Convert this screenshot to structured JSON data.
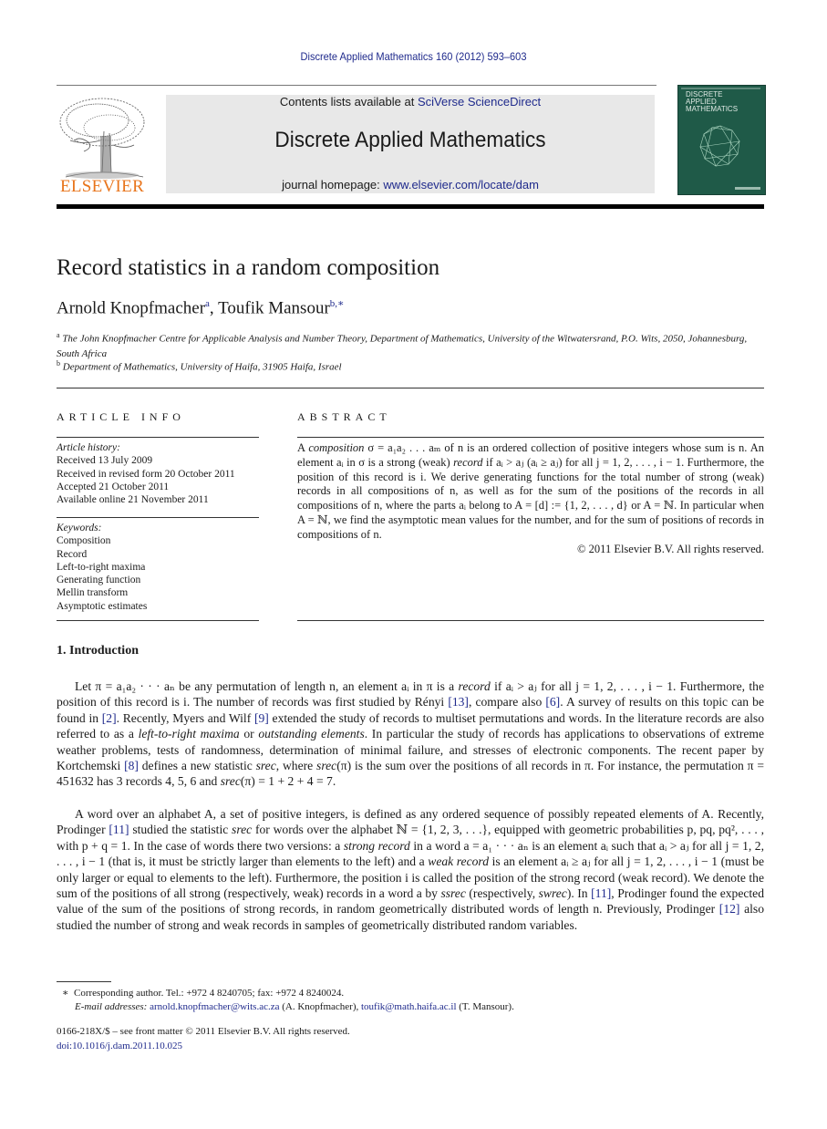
{
  "header": {
    "citation": "Discrete Applied Mathematics 160 (2012) 593–603",
    "contents_prefix": "Contents lists available at ",
    "contents_link": "SciVerse ScienceDirect",
    "journal_title": "Discrete Applied Mathematics",
    "homepage_prefix": "journal homepage: ",
    "homepage_link": "www.elsevier.com/locate/dam",
    "publisher_logo_text": "ELSEVIER",
    "cover_title_lines": [
      "DISCRETE",
      "APPLIED",
      "MATHEMATICS"
    ],
    "colors": {
      "link": "#1f2a8c",
      "elsevier_orange": "#e8741b",
      "cover_green": "#1f5a48",
      "banner_gray": "#e8e8e8"
    }
  },
  "article": {
    "title": "Record statistics in a random composition",
    "authors": [
      {
        "name": "Arnold Knopfmacher",
        "sup": "a"
      },
      {
        "name": "Toufik Mansour",
        "sup": "b,∗"
      }
    ],
    "author_separator": ", ",
    "affiliations": [
      {
        "sup": "a",
        "text": "The John Knopfmacher Centre for Applicable Analysis and Number Theory, Department of Mathematics, University of the Witwatersrand, P.O. Wits, 2050, Johannesburg, South Africa"
      },
      {
        "sup": "b",
        "text": "Department of Mathematics, University of Haifa, 31905 Haifa, Israel"
      }
    ]
  },
  "article_info": {
    "heading": "ARTICLE INFO",
    "history_label": "Article history:",
    "history": [
      "Received 13 July 2009",
      "Received in revised form 20 October 2011",
      "Accepted 21 October 2011",
      "Available online 21 November 2011"
    ],
    "keywords_label": "Keywords:",
    "keywords": [
      "Composition",
      "Record",
      "Left-to-right maxima",
      "Generating function",
      "Mellin transform",
      "Asymptotic estimates"
    ]
  },
  "abstract": {
    "heading": "ABSTRACT",
    "text_parts": [
      "A ",
      "composition",
      " σ = a₁a₂ . . . aₘ of n is an ordered collection of positive integers whose sum is n. An element aᵢ in σ is a strong (weak) ",
      "record",
      " if aᵢ > aⱼ (aᵢ ≥ aⱼ) for all j = 1, 2, . . . , i − 1. Furthermore, the position of this record is i. We derive generating functions for the total number of strong (weak) records in all compositions of n, as well as for the sum of the positions of the records in all compositions of n, where the parts aᵢ belong to A = [d] := {1, 2, . . . , d} or A = ℕ. In particular when A = ℕ, we find the asymptotic mean values for the number, and for the sum of positions of records in compositions of n."
    ],
    "copyright": "© 2011 Elsevier B.V. All rights reserved."
  },
  "introduction": {
    "heading": "1.  Introduction",
    "para1": [
      "Let π = a₁a₂ · · · aₙ be any permutation of length n, an element aᵢ in π is a ",
      "record",
      " if aᵢ > aⱼ for all j = 1, 2, . . . , i − 1. Furthermore, the position of this record is i. The number of records was first studied by Rényi ",
      "[13]",
      ", compare also ",
      "[6]",
      ". A survey of results on this topic can be found in ",
      "[2]",
      ". Recently, Myers and Wilf ",
      "[9]",
      " extended the study of records to multiset permutations and words. In the literature records are also referred to as a ",
      "left-to-right maxima",
      " or ",
      "outstanding elements",
      ". In particular the study of records has applications to observations of extreme weather problems, tests of randomness, determination of minimal failure, and stresses of electronic components. The recent paper by Kortchemski ",
      "[8]",
      " defines a new statistic ",
      "srec",
      ", where ",
      "srec",
      "(π) is the sum over the positions of all records in π. For instance, the permutation π = 451632 has 3 records 4, 5, 6 and ",
      "srec",
      "(π) = 1 + 2 + 4 = 7."
    ],
    "para2": [
      "A word over an alphabet A, a set of positive integers, is defined as any ordered sequence of possibly repeated elements of A. Recently, Prodinger ",
      "[11]",
      " studied the statistic ",
      "srec",
      " for words over the alphabet ℕ = {1, 2, 3, . . .}, equipped with geometric probabilities p, pq, pq², . . . , with p + q = 1. In the case of words there two versions: a ",
      "strong record",
      " in a word a = a₁ · · · aₙ is an element aᵢ such that aᵢ > aⱼ for all j = 1, 2, . . . , i − 1 (that is, it must be strictly larger than elements to the left) and a ",
      "weak record",
      " is an element aᵢ ≥ aⱼ for all j = 1, 2, . . . , i − 1 (must be only larger or equal to elements to the left). Furthermore, the position i is called the position of the strong record (weak record). We denote the sum of the positions of all strong (respectively, weak) records in a word a by ",
      "ssrec",
      " (respectively, ",
      "swrec",
      "). In ",
      "[11]",
      ", Prodinger found the expected value of the sum of the positions of strong records, in random geometrically distributed words of length n. Previously, Prodinger ",
      "[12]",
      " also studied the number of strong and weak records in samples of geometrically distributed random variables."
    ]
  },
  "footnotes": {
    "corresponding_mark": "∗",
    "corresponding": "Corresponding author. Tel.: +972 4 8240705; fax: +972 4 8240024.",
    "email_label": "E-mail addresses: ",
    "email1": "arnold.knopfmacher@wits.ac.za",
    "email1_owner": " (A. Knopfmacher), ",
    "email2": "toufik@math.haifa.ac.il",
    "email2_owner": " (T. Mansour).",
    "issn": "0166-218X/$ – see front matter © 2011 Elsevier B.V. All rights reserved.",
    "doi": "doi:10.1016/j.dam.2011.10.025"
  }
}
